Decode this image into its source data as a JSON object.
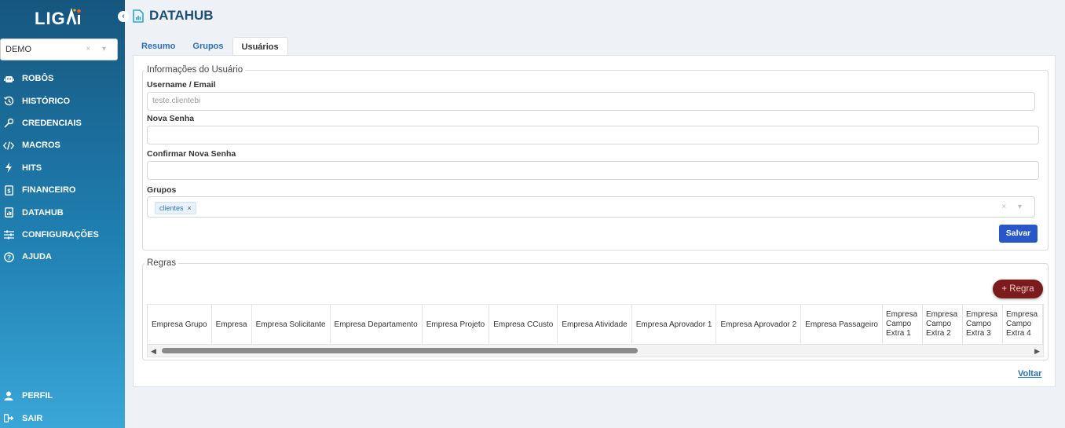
{
  "app": {
    "logo_text": "LIGAi"
  },
  "sidebar": {
    "tenant_select": {
      "value": "DEMO"
    },
    "items": [
      {
        "label": "ROBÔS",
        "icon": "robot-icon"
      },
      {
        "label": "HISTÓRICO",
        "icon": "history-icon"
      },
      {
        "label": "CREDENCIAIS",
        "icon": "key-icon"
      },
      {
        "label": "MACROS",
        "icon": "code-icon"
      },
      {
        "label": "HITS",
        "icon": "bolt-icon"
      },
      {
        "label": "FINANCEIRO",
        "icon": "invoice-icon"
      },
      {
        "label": "DATAHUB",
        "icon": "chart-file-icon"
      },
      {
        "label": "CONFIGURAÇÕES",
        "icon": "sliders-icon"
      },
      {
        "label": "AJUDA",
        "icon": "help-icon"
      }
    ],
    "bottom_items": [
      {
        "label": "PERFIL",
        "icon": "user-icon"
      },
      {
        "label": "SAIR",
        "icon": "logout-icon"
      }
    ]
  },
  "header": {
    "title": "DATAHUB"
  },
  "tabs": [
    {
      "label": "Resumo",
      "active": false
    },
    {
      "label": "Grupos",
      "active": false
    },
    {
      "label": "Usuários",
      "active": true
    }
  ],
  "user_form": {
    "legend": "Informações do Usuário",
    "username_label": "Username / Email",
    "username_value": "teste.clientebi",
    "new_password_label": "Nova Senha",
    "new_password_value": "",
    "confirm_password_label": "Confirmar Nova Senha",
    "confirm_password_value": "",
    "groups_label": "Grupos",
    "groups_selected": [
      "clientes"
    ],
    "save_label": "Salvar"
  },
  "rules": {
    "legend": "Regras",
    "add_label": "+ Regra",
    "columns": [
      "Empresa Grupo",
      "Empresa",
      "Empresa Solicitante",
      "Empresa Departamento",
      "Empresa Projeto",
      "Empresa CCusto",
      "Empresa Atividade",
      "Empresa Aprovador 1",
      "Empresa Aprovador 2",
      "Empresa Passageiro",
      "Empresa Campo Extra 1",
      "Empresa Campo Extra 2",
      "Empresa Campo Extra 3",
      "Empresa Campo Extra 4"
    ]
  },
  "footer": {
    "back_label": "Voltar"
  },
  "colors": {
    "accent": "#2a57c8",
    "add_rule": "#7a1c1c",
    "sidebar_top": "#16567e",
    "sidebar_bottom": "#3aa6d8"
  }
}
